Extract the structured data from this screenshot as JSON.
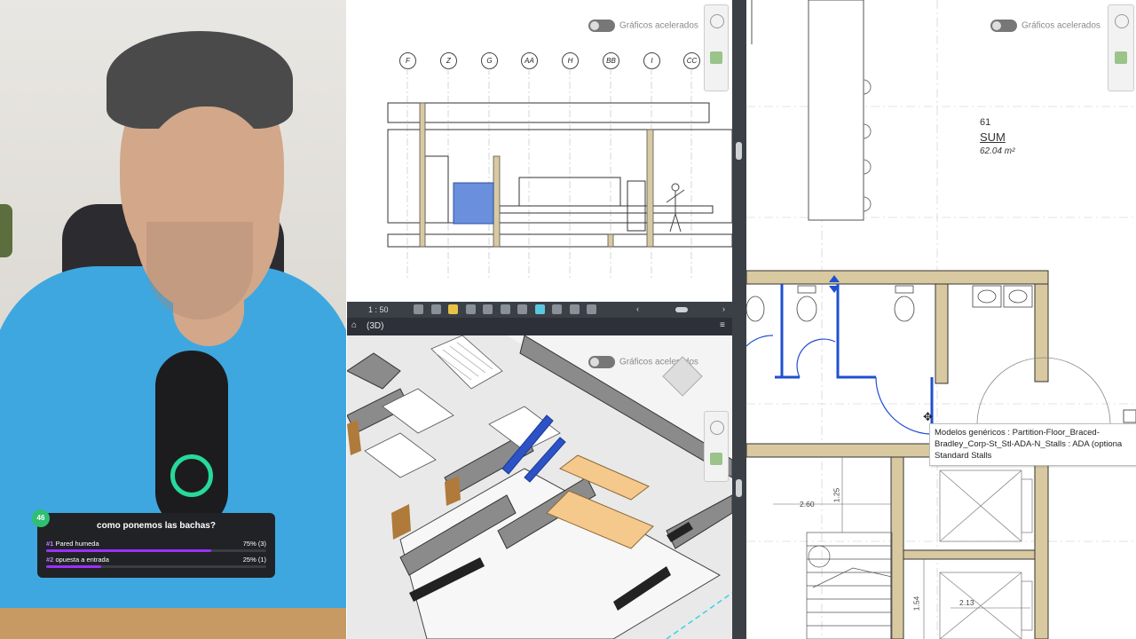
{
  "poll": {
    "badge": "46",
    "question": "como ponemos las bachas?",
    "options": [
      {
        "num": "#1",
        "label": "Pared humeda",
        "result": "75% (3)",
        "fraction": 0.75
      },
      {
        "num": "#2",
        "label": "opuesta a entrada",
        "result": "25% (1)",
        "fraction": 0.25
      }
    ]
  },
  "elevation_view": {
    "accel_label": "Gráficos acelerados",
    "grid_bubbles": [
      "F",
      "Z",
      "G",
      "AA",
      "H",
      "BB",
      "I",
      "CC"
    ]
  },
  "view_control_bar": {
    "scale": "1 : 50"
  },
  "view_3d": {
    "tab_title": "(3D)",
    "accel_label": "Gráficos acelerados"
  },
  "plan_view": {
    "accel_label": "Gráficos acelerados",
    "room_number": "61",
    "room_name": "SUM",
    "room_area": "62.04 m²",
    "dimensions": [
      "2.60",
      "1.25",
      "1.54",
      "2.13"
    ],
    "tooltip_lines": [
      "Modelos genéricos : Partition-Floor_Braced-",
      "Bradley_Corp-St_Stl-ADA-N_Stalls : ADA (optiona",
      "Standard Stalls"
    ]
  },
  "colors": {
    "shirt": "#3ea7e0",
    "selection_blue": "#1f4fd1",
    "wall_fill": "#d8c9a0",
    "table_fill": "#f5c88c",
    "poll_bg": "#202226",
    "poll_bar": "#9b30ff"
  }
}
